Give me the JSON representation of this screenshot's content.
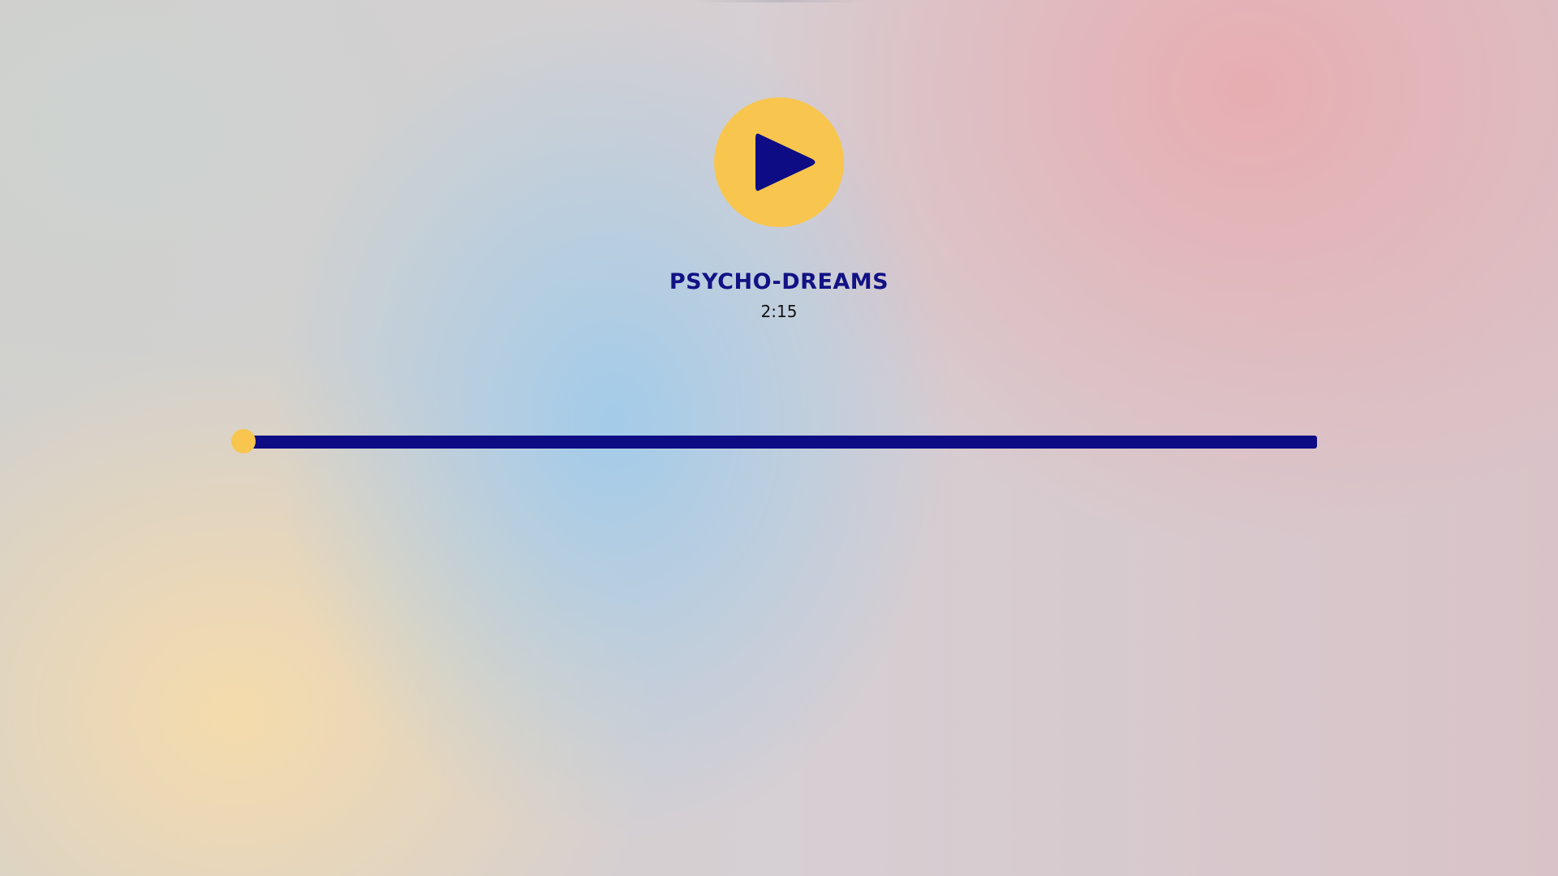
{
  "player": {
    "track_title": "PSYCHO-DREAMS",
    "duration": "2:15",
    "play_icon": "play-icon",
    "progress_fraction": 0
  },
  "colors": {
    "accent": "#f8c64f",
    "primary": "#0d0c84",
    "title_text": "#121284",
    "duration_text": "#111111"
  }
}
